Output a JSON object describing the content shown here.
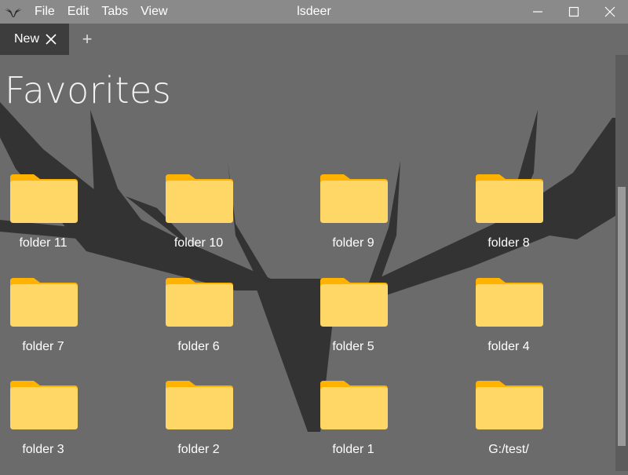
{
  "window": {
    "title": "lsdeer",
    "menu": [
      "File",
      "Edit",
      "Tabs",
      "View"
    ],
    "controls": [
      "minimize",
      "maximize",
      "close"
    ]
  },
  "tabs": {
    "items": [
      {
        "label": "New",
        "active": true
      }
    ],
    "add_label": "+"
  },
  "main": {
    "heading": "Favorites",
    "folders": [
      {
        "label": "folder 11"
      },
      {
        "label": "folder 10"
      },
      {
        "label": "folder 9"
      },
      {
        "label": "folder 8"
      },
      {
        "label": "folder 7"
      },
      {
        "label": "folder 6"
      },
      {
        "label": "folder 5"
      },
      {
        "label": "folder 4"
      },
      {
        "label": "folder 3"
      },
      {
        "label": "folder 2"
      },
      {
        "label": "folder 1"
      },
      {
        "label": "G:/test/"
      }
    ]
  },
  "colors": {
    "background": "#6b6b6b",
    "titlebar": "#8a8a8a",
    "active_tab": "#3d3d3d",
    "antler": "#333333",
    "folder_front": "#FFD766",
    "folder_back": "#FFB300"
  }
}
